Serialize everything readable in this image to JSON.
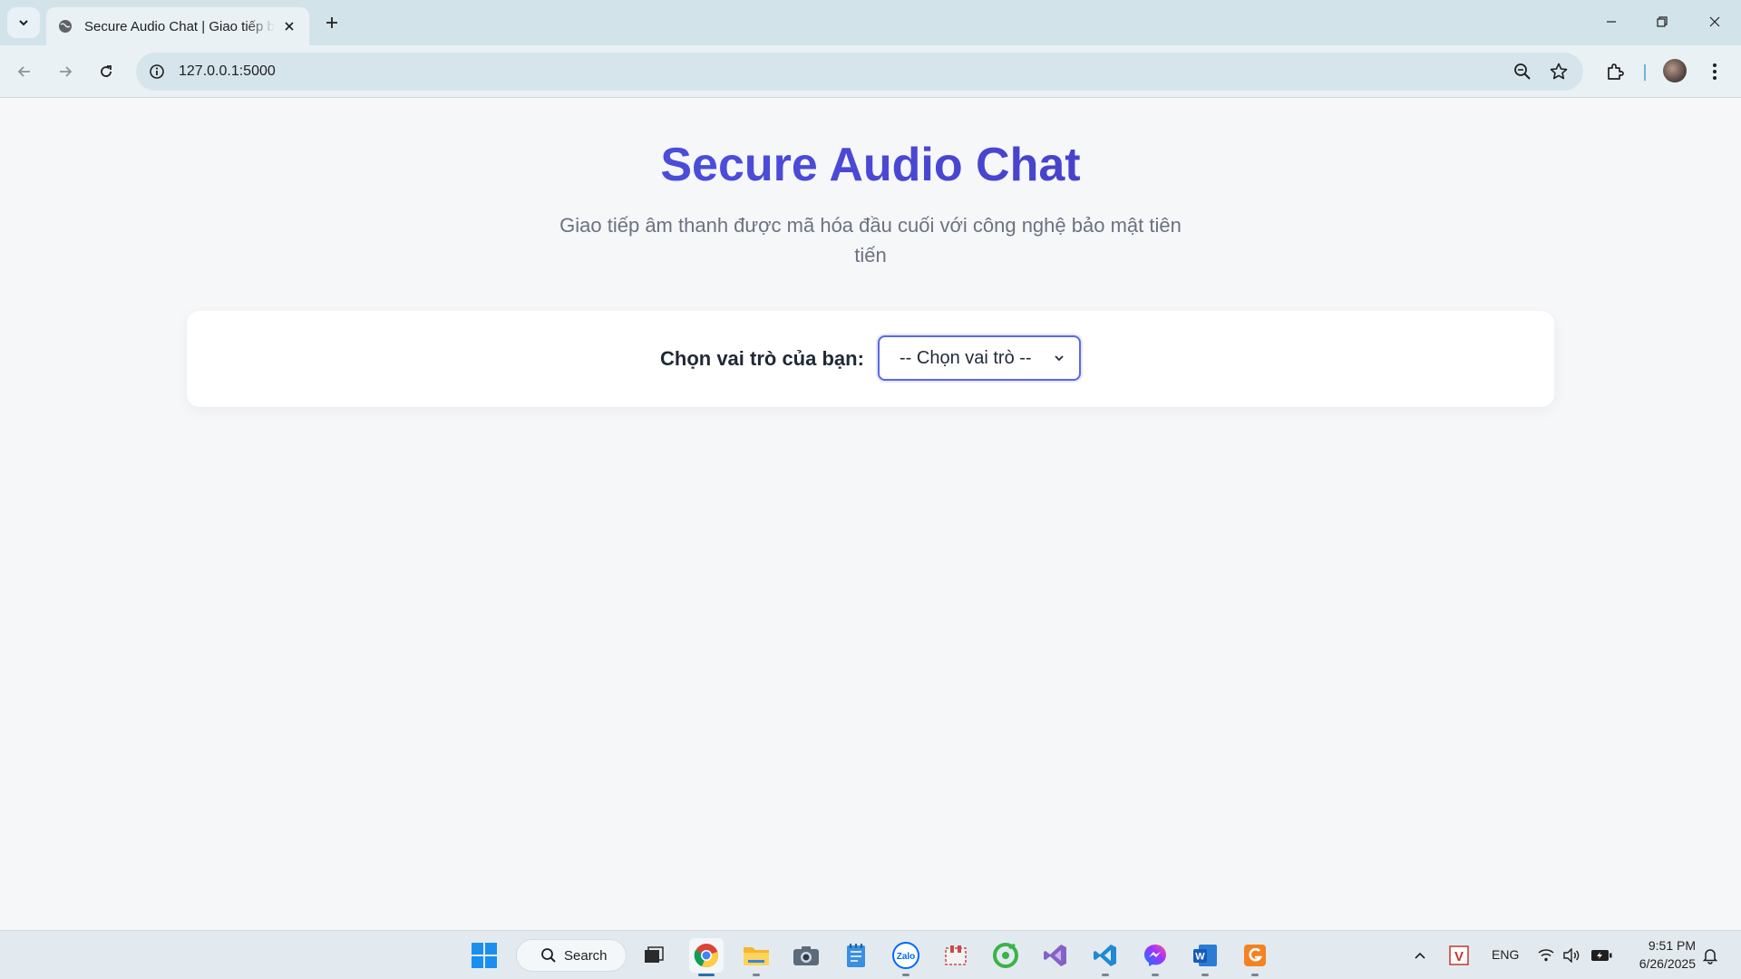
{
  "browser": {
    "tab_title": "Secure Audio Chat | Giao tiếp bảo mật",
    "url": "127.0.0.1:5000"
  },
  "page": {
    "title": "Secure Audio Chat",
    "subtitle": "Giao tiếp âm thanh được mã hóa đầu cuối với công nghệ bảo mật tiên tiến",
    "role_label": "Chọn vai trò của bạn:",
    "role_select_value": "-- Chọn vai trò --",
    "colors": {
      "title_start": "#4a5ae0",
      "title_end": "#3d2fb0",
      "select_border": "#5b68e0"
    }
  },
  "taskbar": {
    "search_label": "Search",
    "language": "ENG",
    "time": "9:51 PM",
    "date": "6/26/2025",
    "apps": [
      "windows-start-icon",
      "task-view-icon",
      "chrome-icon",
      "file-explorer-icon",
      "camera-icon",
      "notepad-icon",
      "zalo-icon",
      "snipping-tool-icon",
      "coccoc-icon",
      "visual-studio-icon",
      "vscode-icon",
      "messenger-icon",
      "word-icon",
      "foxit-pdf-icon"
    ]
  }
}
